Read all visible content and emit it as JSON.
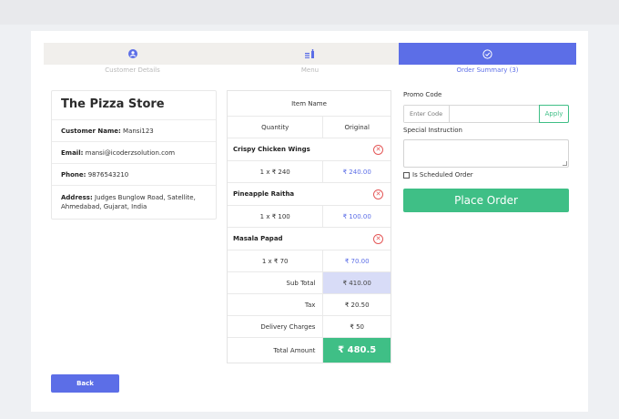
{
  "steps": [
    {
      "label": "Customer Details",
      "icon": "user-circle-icon"
    },
    {
      "label": "Menu",
      "icon": "menu-icon"
    },
    {
      "label": "Order Summary (3)",
      "icon": "check-circle-icon"
    }
  ],
  "store": {
    "title": "The Pizza Store",
    "customer_name_label": "Customer Name:",
    "customer_name": "Mansi123",
    "email_label": "Email:",
    "email": "mansi@icoderzsolution.com",
    "phone_label": "Phone:",
    "phone": "9876543210",
    "address_label": "Address:",
    "address": "Judges Bunglow Road, Satellite, Ahmedabad, Gujarat, India"
  },
  "table": {
    "header": "Item Name",
    "col_quantity": "Quantity",
    "col_original": "Original",
    "items": [
      {
        "name": "Crispy Chicken Wings",
        "qty": "1 x ₹ 240",
        "price": "₹ 240.00"
      },
      {
        "name": "Pineapple Raitha",
        "qty": "1 x ₹ 100",
        "price": "₹ 100.00"
      },
      {
        "name": "Masala Papad",
        "qty": "1 x ₹ 70",
        "price": "₹ 70.00"
      }
    ],
    "subtotal_label": "Sub Total",
    "subtotal": "₹ 410.00",
    "tax_label": "Tax",
    "tax": "₹ 20.50",
    "delivery_label": "Delivery Charges",
    "delivery": "₹ 50",
    "total_label": "Total Amount",
    "total": "₹ 480.5"
  },
  "right": {
    "promo_label": "Promo Code",
    "promo_placeholder": "Enter Code",
    "apply": "Apply",
    "special_label": "Special Instruction",
    "scheduled_label": "Is Scheduled Order",
    "place_order": "Place Order"
  },
  "back": "Back",
  "colors": {
    "accent": "#5c6ee7",
    "green": "#3fbf86",
    "remove": "#e45858"
  }
}
